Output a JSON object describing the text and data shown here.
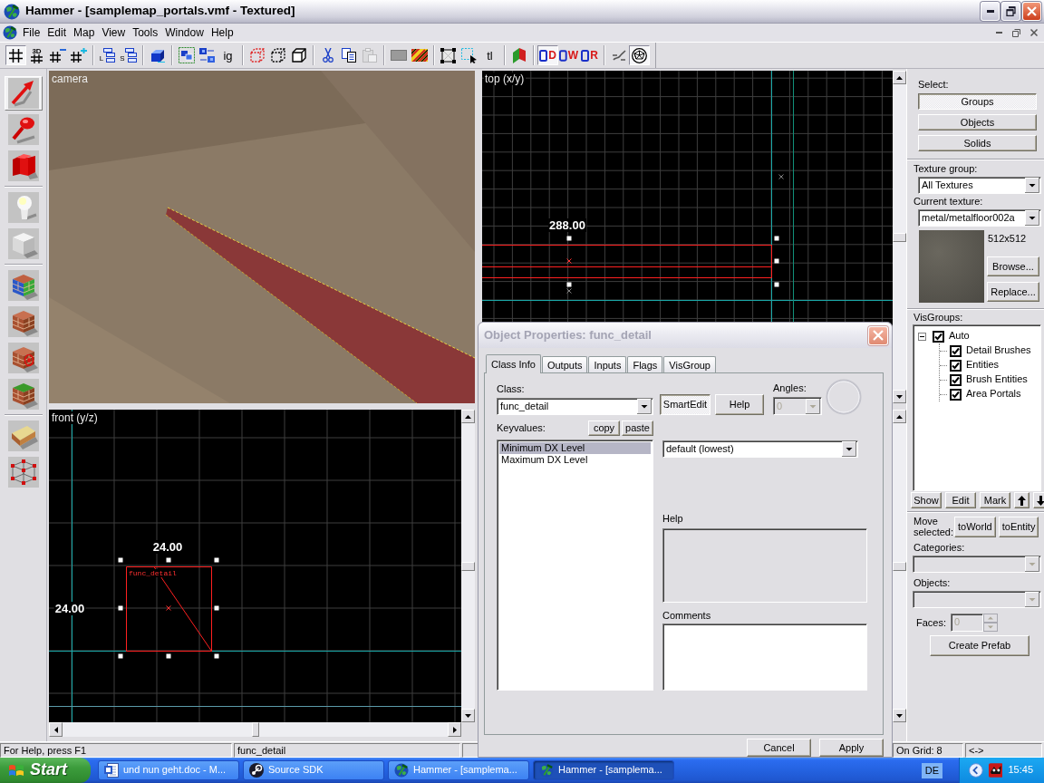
{
  "window": {
    "title": "Hammer - [samplemap_portals.vmf - Textured]"
  },
  "menu": [
    "File",
    "Edit",
    "Map",
    "View",
    "Tools",
    "Window",
    "Help"
  ],
  "toolbar": [
    [
      {
        "pressed": true,
        "disabled": false
      },
      {
        "label": "3D",
        "pressed": false,
        "disabled": false
      },
      {
        "pressed": false,
        "disabled": false
      },
      {
        "pressed": false,
        "disabled": false
      }
    ],
    [
      {
        "label": "L",
        "pressed": false,
        "disabled": false
      },
      {
        "label": "S",
        "pressed": false,
        "disabled": false
      }
    ],
    [
      {
        "pressed": false,
        "disabled": false
      }
    ],
    [
      {
        "pressed": false,
        "disabled": false
      },
      {
        "pressed": false,
        "disabled": false
      },
      {
        "label": "ig",
        "pressed": false,
        "disabled": false
      }
    ],
    [
      {
        "pressed": false,
        "disabled": false
      },
      {
        "pressed": false,
        "disabled": false
      },
      {
        "pressed": false,
        "disabled": false
      }
    ],
    [
      {
        "pressed": false,
        "disabled": false
      },
      {
        "pressed": false,
        "disabled": false
      },
      {
        "pressed": false,
        "disabled": true
      }
    ],
    [
      {
        "pressed": false,
        "disabled": false
      },
      {
        "pressed": false,
        "disabled": false
      }
    ],
    [
      {
        "pressed": false,
        "disabled": false
      },
      {
        "pressed": false,
        "disabled": false
      },
      {
        "label": "tl",
        "pressed": false,
        "disabled": false
      }
    ],
    [
      {
        "pressed": false,
        "disabled": false
      }
    ],
    [
      {
        "label": "D",
        "pressed": true,
        "disabled": false
      },
      {
        "label": "W",
        "pressed": false,
        "disabled": false
      },
      {
        "label": "R",
        "pressed": false,
        "disabled": false
      }
    ],
    [
      {
        "pressed": false,
        "disabled": false
      },
      {
        "pressed": true,
        "disabled": false
      }
    ]
  ],
  "tools": [
    [
      {
        "selected": true
      },
      {
        "selected": false
      },
      {
        "selected": false
      }
    ],
    [
      {
        "selected": false
      },
      {
        "selected": false
      }
    ],
    [
      {
        "selected": false
      },
      {
        "selected": false
      },
      {
        "selected": false
      },
      {
        "selected": false
      }
    ],
    [
      {
        "selected": false
      },
      {
        "selected": false
      }
    ]
  ],
  "viewports": {
    "camera": {
      "label": "camera"
    },
    "top": {
      "label": "top (x/y)",
      "width_reading": "288.00"
    },
    "front": {
      "label": "front (y/z)",
      "width_reading": "24.00",
      "height_reading": "24.00",
      "object_name": "func_detail"
    }
  },
  "side_panel": {
    "select": {
      "label": "Select:",
      "buttons": [
        {
          "label": "Groups",
          "selected": true
        },
        {
          "label": "Objects",
          "selected": false
        },
        {
          "label": "Solids",
          "selected": false
        }
      ]
    },
    "texture_group": {
      "label": "Texture group:",
      "value": "All Textures"
    },
    "current_texture": {
      "label": "Current texture:",
      "value": "metal/metalfloor002a",
      "size": "512x512"
    },
    "texture_buttons": [
      "Browse...",
      "Replace..."
    ],
    "visgroups": {
      "label": "VisGroups:",
      "tree": [
        {
          "label": "Auto",
          "checked": true,
          "expanded": true,
          "children": [
            {
              "label": "Detail Brushes",
              "checked": true
            },
            {
              "label": "Entities",
              "checked": true
            },
            {
              "label": "Brush Entities",
              "checked": true
            },
            {
              "label": "Area Portals",
              "checked": true
            }
          ]
        }
      ],
      "buttons": [
        "Show",
        "Edit",
        "Mark"
      ]
    },
    "move_selected": {
      "label": "Move selected:",
      "buttons": [
        "toWorld",
        "toEntity"
      ]
    },
    "categories": {
      "label": "Categories:",
      "disabled": true
    },
    "objects": {
      "label": "Objects:",
      "disabled": true
    },
    "faces": {
      "label": "Faces:",
      "value": "0",
      "disabled": true
    },
    "create_prefab": "Create Prefab"
  },
  "dialog": {
    "title": "Object Properties: func_detail",
    "tabs": [
      {
        "label": "Class Info",
        "selected": true
      },
      {
        "label": "Outputs",
        "selected": false
      },
      {
        "label": "Inputs",
        "selected": false
      },
      {
        "label": "Flags",
        "selected": false
      },
      {
        "label": "VisGroup",
        "selected": false
      }
    ],
    "class": {
      "label": "Class:",
      "value": "func_detail"
    },
    "smartedit": {
      "label": "SmartEdit",
      "pressed": true
    },
    "help_button": "Help",
    "angles": {
      "label": "Angles:",
      "value": "0",
      "disabled": true
    },
    "keyvalues_label": "Keyvalues:",
    "copy_button": "copy",
    "paste_button": "paste",
    "keyvalues": [
      {
        "label": "Minimum DX Level",
        "selected": true
      },
      {
        "label": "Maximum DX Level",
        "selected": false
      }
    ],
    "value": "default (lowest)",
    "help_label": "Help",
    "comments_label": "Comments",
    "buttons": [
      "Cancel",
      "Apply"
    ]
  },
  "status_bar": {
    "hint": "For Help, press F1",
    "selection": "func_detail",
    "grid": "On Grid: 8",
    "mode": "<->"
  },
  "taskbar": {
    "start": "Start",
    "tasks": [
      {
        "label": "und nun geht.doc - M...",
        "selected": false
      },
      {
        "label": "Source SDK",
        "selected": false
      },
      {
        "label": "Hammer - [samplema...",
        "selected": false
      },
      {
        "label": "Hammer - [samplema...",
        "selected": true
      }
    ],
    "language": "DE",
    "clock": "15:45"
  }
}
